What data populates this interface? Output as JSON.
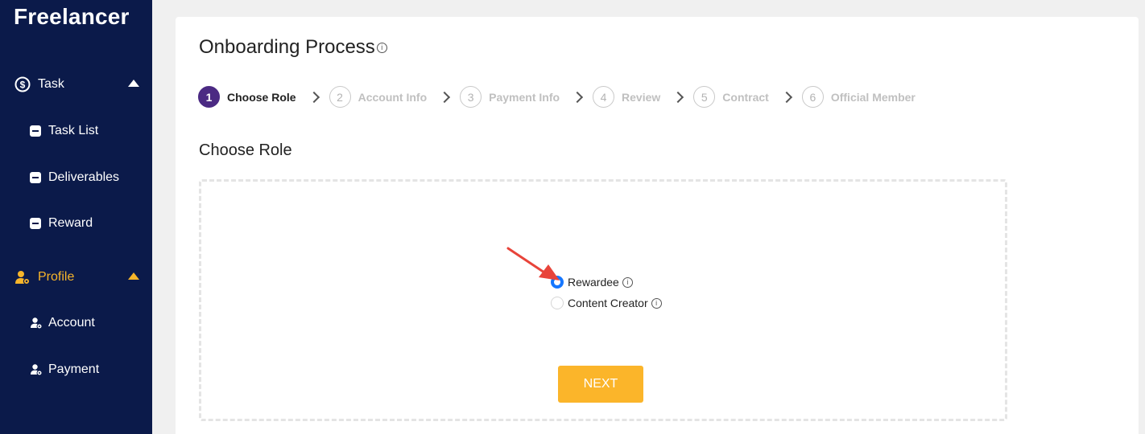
{
  "sidebar": {
    "brand": "Freelancer",
    "groups": [
      {
        "label": "Task",
        "icon": "dollar-circle-icon",
        "items": [
          {
            "label": "Task List",
            "icon": "document-icon"
          },
          {
            "label": "Deliverables",
            "icon": "document-icon"
          },
          {
            "label": "Reward",
            "icon": "document-icon"
          }
        ]
      },
      {
        "label": "Profile",
        "icon": "user-gear-icon",
        "active": true,
        "items": [
          {
            "label": "Account",
            "icon": "user-gear-icon"
          },
          {
            "label": "Payment",
            "icon": "user-gear-icon"
          }
        ]
      }
    ],
    "colors": {
      "background": "#0b1a4a",
      "active": "#f7b52a"
    }
  },
  "main": {
    "title": "Onboarding Process",
    "title_info_icon": "info-icon",
    "steps": [
      {
        "num": "1",
        "label": "Choose Role",
        "current": true
      },
      {
        "num": "2",
        "label": "Account Info"
      },
      {
        "num": "3",
        "label": "Payment Info"
      },
      {
        "num": "4",
        "label": "Review"
      },
      {
        "num": "5",
        "label": "Contract"
      },
      {
        "num": "6",
        "label": "Official Member"
      }
    ],
    "section_title": "Choose Role",
    "roles": [
      {
        "label": "Rewardee",
        "selected": true
      },
      {
        "label": "Content Creator",
        "selected": false
      }
    ],
    "next_label": "NEXT",
    "colors": {
      "step_current": "#4b2a83",
      "radio": "#1677ff",
      "button": "#fbb52a"
    }
  }
}
